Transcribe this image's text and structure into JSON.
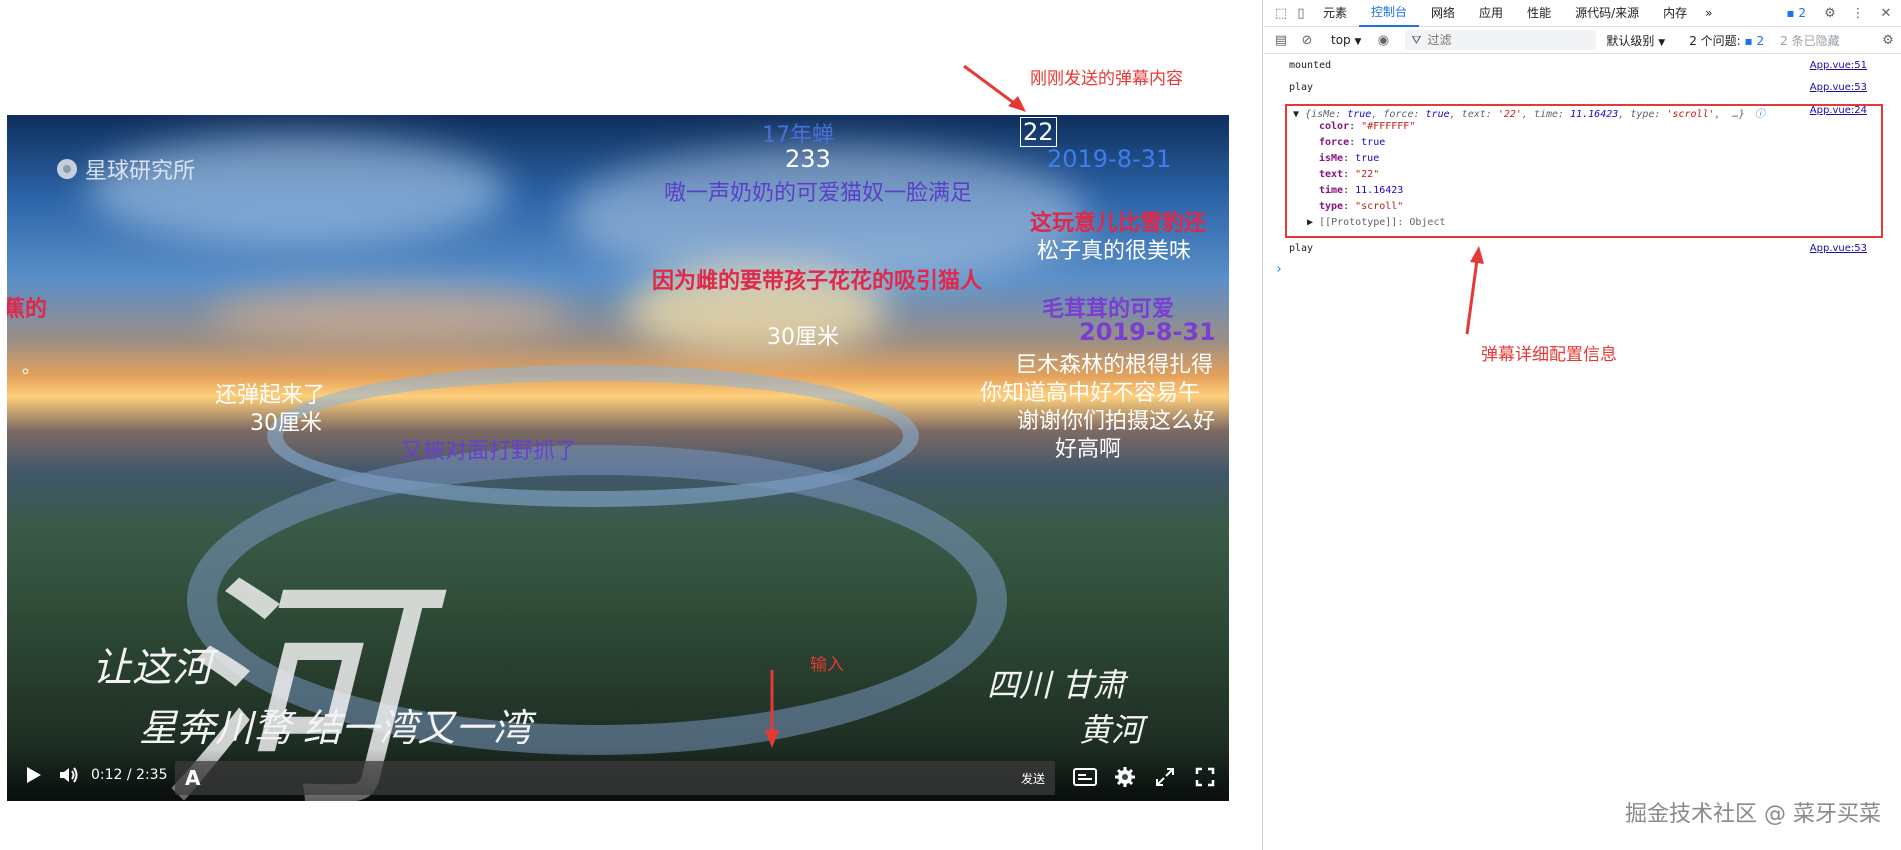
{
  "video": {
    "logo_text": "星球研究所",
    "calligraphy_big": "河",
    "calligraphy_line1": "让这河",
    "calligraphy_line2": "星奔川骛 结一湾又一湾",
    "calligraphy_right1": "四川 甘肃",
    "calligraphy_right2": "黄河",
    "danmaku": [
      {
        "text": "17年蝉",
        "color": "#4a6fd8"
      },
      {
        "text": "22",
        "color": "#ffffff"
      },
      {
        "text": "233",
        "color": "#ffffff"
      },
      {
        "text": "2019-8-31",
        "color": "#3f7ef0"
      },
      {
        "text": "嗷一声奶奶的可爱猫奴一脸满足",
        "color": "#5b3fc8"
      },
      {
        "text": "这玩意儿比雪豹还",
        "color": "#e0284a"
      },
      {
        "text": "松子真的很美味",
        "color": "#ffffff"
      },
      {
        "text": "因为雌的要带孩子花花的吸引猫人",
        "color": "#e0284a"
      },
      {
        "text": "毛茸茸的可爱",
        "color": "#7a3fd0"
      },
      {
        "text": "2019-8-31",
        "color": "#7a3fd0"
      },
      {
        "text": "蕉的",
        "color": "#e0284a"
      },
      {
        "text": "30厘米",
        "color": "#ffffff"
      },
      {
        "text": "巨木森林的根得扎得",
        "color": "#ffffff"
      },
      {
        "text": "你知道高中好不容易午",
        "color": "#ffffff"
      },
      {
        "text": "谢谢你们拍摄这么好",
        "color": "#ffffff"
      },
      {
        "text": "好高啊",
        "color": "#ffffff"
      },
      {
        "text": "还弹起来了",
        "color": "#ffffff"
      },
      {
        "text": "30厘米",
        "color": "#ffffff"
      },
      {
        "text": "又被对面打野抓了",
        "color": "#6a3fd0"
      },
      {
        "text": "。",
        "color": "#ffffff"
      }
    ],
    "controls": {
      "time": "0:12 / 2:35",
      "input_prefix": "A",
      "input_value": "",
      "send_label": "发送"
    }
  },
  "annotations": {
    "just_sent": "刚刚发送的弹幕内容",
    "input": "输入",
    "config": "弹幕详细配置信息"
  },
  "devtools": {
    "tabs": [
      "元素",
      "控制台",
      "网络",
      "应用",
      "性能",
      "源代码/来源",
      "内存"
    ],
    "active_tab": "控制台",
    "more_tabs": "»",
    "badge": "2",
    "context": "top",
    "filter_placeholder": "过滤",
    "level": "默认级别",
    "issues": "2 个问题:",
    "issues_badge": "2",
    "hidden": "2 条已隐藏",
    "logs": [
      {
        "msg": "mounted",
        "src": "App.vue:51"
      },
      {
        "msg": "play",
        "src": "App.vue:53"
      },
      {
        "msg": "",
        "src": "App.vue:24"
      },
      {
        "msg": "play",
        "src": "App.vue:53"
      }
    ],
    "object": {
      "summary_isMe_key": "isMe",
      "summary_isMe_val": "true",
      "summary_force_key": "force",
      "summary_force_val": "true",
      "summary_text_key": "text",
      "summary_text_val": "'22'",
      "summary_time_key": "time",
      "summary_time_val": "11.16423",
      "summary_type_key": "type",
      "summary_type_val": "'scroll'",
      "summary_more": "…}",
      "props": [
        {
          "key": "color",
          "val": "\"#FFFFFF\"",
          "kind": "s"
        },
        {
          "key": "force",
          "val": "true",
          "kind": "n"
        },
        {
          "key": "isMe",
          "val": "true",
          "kind": "n"
        },
        {
          "key": "text",
          "val": "\"22\"",
          "kind": "s"
        },
        {
          "key": "time",
          "val": "11.16423",
          "kind": "n"
        },
        {
          "key": "type",
          "val": "\"scroll\"",
          "kind": "s"
        }
      ],
      "proto": "[[Prototype]]: Object"
    },
    "prompt": "›"
  },
  "watermark": "掘金技术社区 @ 菜牙买菜"
}
